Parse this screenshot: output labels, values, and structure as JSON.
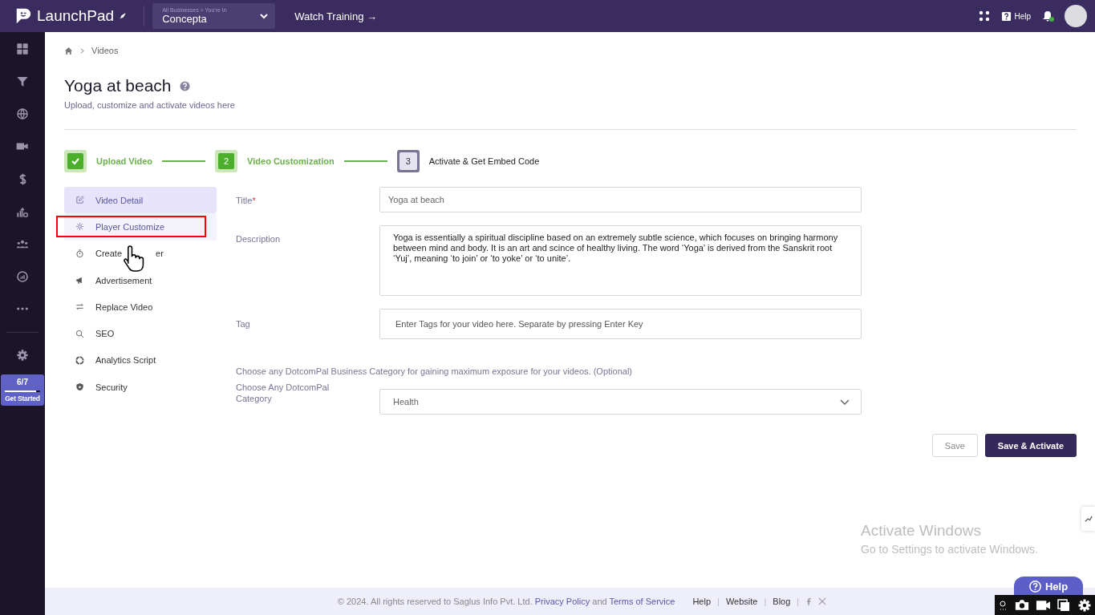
{
  "brand": {
    "name": "LaunchPad"
  },
  "business": {
    "caption": "All Businesses > You're In",
    "name": "Concepta"
  },
  "watch_training": "Watch Training →",
  "topbar_help": "Help",
  "notifications": {
    "unread": true
  },
  "left_nav": {
    "progress": {
      "count": "6/7",
      "level": 0.88,
      "label": "Get Started"
    }
  },
  "breadcrumb": {
    "current": "Videos"
  },
  "page": {
    "title": "Yoga at beach",
    "subtitle": "Upload, customize and activate videos here"
  },
  "steps": [
    {
      "label": "Upload Video",
      "completed": true,
      "reached": true
    },
    {
      "number": "2",
      "label": "Video Customization",
      "completed": false,
      "reached": true
    },
    {
      "number": "3",
      "label": "Activate & Get Embed Code",
      "completed": false,
      "reached": false
    }
  ],
  "menu": [
    {
      "label": "Video Detail",
      "selected": true,
      "hovered": false,
      "outlined": false
    },
    {
      "label": "Player Customize",
      "selected": false,
      "hovered": true,
      "outlined": true
    },
    {
      "label": "Create",
      "label_tail": "er",
      "selected": false,
      "hovered": false,
      "outlined": false
    },
    {
      "label": "Advertisement",
      "selected": false,
      "hovered": false,
      "outlined": false
    },
    {
      "label": "Replace Video",
      "selected": false,
      "hovered": false,
      "outlined": false
    },
    {
      "label": "SEO",
      "selected": false,
      "hovered": false,
      "outlined": false
    },
    {
      "label": "Analytics Script",
      "selected": false,
      "hovered": false,
      "outlined": false
    },
    {
      "label": "Security",
      "selected": false,
      "hovered": false,
      "outlined": false
    }
  ],
  "form": {
    "title": {
      "label": "Title",
      "required_mark": "*",
      "value": "Yoga at beach"
    },
    "description": {
      "label": "Description",
      "value": "Yoga is essentially a spiritual discipline based on an extremely subtle science, which focuses on bringing harmony between mind and body. It is an art and scince of healthy living. The word ‘Yoga’ is derived from the Sanskrit root ‘Yuj’, meaning ‘to join’ or ‘to yoke’ or ‘to unite’."
    },
    "tag": {
      "label": "Tag",
      "placeholder": "Enter Tags for your video here. Separate by pressing Enter Key"
    },
    "category_hint": "Choose any DotcomPal Business Category for gaining maximum exposure for your videos. (Optional)",
    "category": {
      "label": "Choose Any DotcomPal Category",
      "value": "Health"
    }
  },
  "actions": [
    {
      "label": "Save",
      "kind": "secondary"
    },
    {
      "label": "Save & Activate",
      "kind": "primary"
    }
  ],
  "footer": {
    "copyright": "©  2024. All rights reserved to Saglus Info Pvt. Ltd.",
    "privacy": "Privacy Policy",
    "joiner": "and",
    "terms": "Terms of Service",
    "links": [
      {
        "label": "Help",
        "separator": "|"
      },
      {
        "label": "Website",
        "separator": "|"
      },
      {
        "label": "Blog",
        "separator": "|"
      }
    ]
  },
  "os_notice": {
    "title": "Activate Windows",
    "text": "Go to Settings to activate Windows."
  },
  "help_button": {
    "label": "Help"
  }
}
